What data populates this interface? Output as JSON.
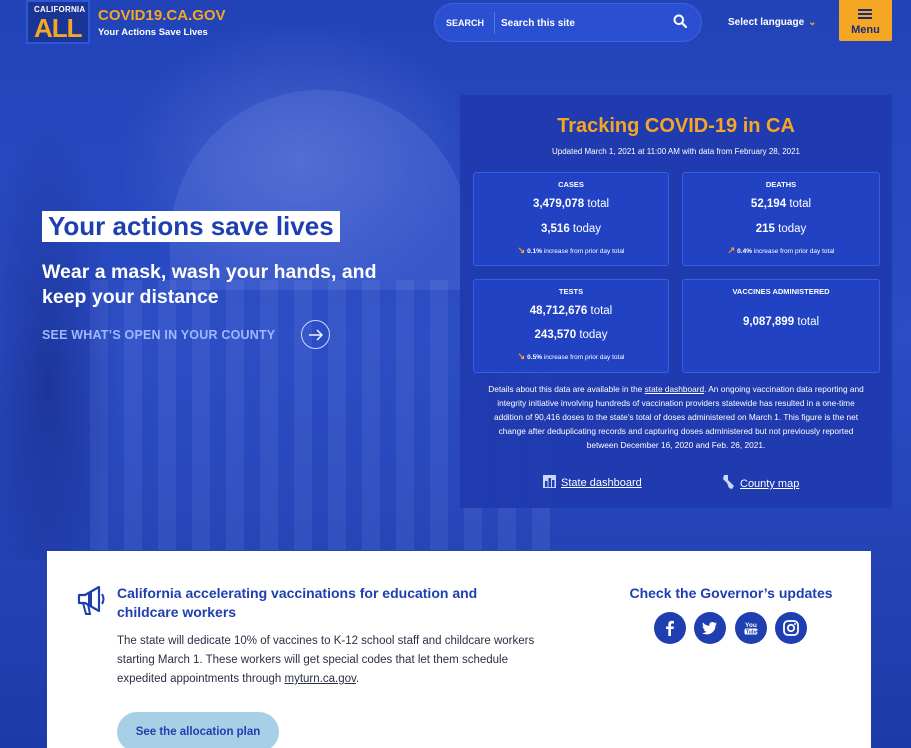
{
  "header": {
    "logo_small": "CALIFORNIA",
    "logo_big": "ALL",
    "site_title": "COVID19.CA.GOV",
    "site_subtitle": "Your Actions Save Lives",
    "search_label": "SEARCH",
    "search_placeholder": "Search this site",
    "language_label": "Select language",
    "menu_label": "Menu"
  },
  "hero": {
    "title": "Your actions save lives",
    "subtitle": "Wear a mask, wash your hands, and keep your distance",
    "link": "SEE WHAT’S OPEN IN YOUR COUNTY"
  },
  "tracking": {
    "title": "Tracking COVID-19 in CA",
    "updated": "Updated March 1, 2021 at 11:00 AM with data from February 28, 2021",
    "cards": {
      "cases": {
        "heading": "CASES",
        "total": "3,479,078",
        "total_unit": "total",
        "today": "3,516",
        "today_unit": "today",
        "change_pct": "0.1%",
        "change_text": "increase from prior day total"
      },
      "deaths": {
        "heading": "DEATHS",
        "total": "52,194",
        "total_unit": "total",
        "today": "215",
        "today_unit": "today",
        "change_pct": "0.4%",
        "change_text": "increase from prior day total"
      },
      "tests": {
        "heading": "TESTS",
        "total": "48,712,676",
        "total_unit": "total",
        "today": "243,570",
        "today_unit": "today",
        "change_pct": "0.5%",
        "change_text": "increase from prior day total"
      },
      "vaccines": {
        "heading": "VACCINES ADMINISTERED",
        "total": "9,087,899",
        "total_unit": "total"
      }
    },
    "note_pre": "Details about this data are available in the ",
    "note_link": "state dashboard",
    "note_post": ". An ongoing vaccination data reporting and integrity initiative involving hundreds of vaccination providers statewide has resulted in a one-time addition of 90,416 doses to the state’s total of doses administered on March 1. This figure is the net change after deduplicating records and capturing doses administered but not previously reported between December 16, 2020 and Feb. 26, 2021.",
    "link_dashboard": "State dashboard",
    "link_county": "County map"
  },
  "news": {
    "title": "California accelerating vaccinations for education and childcare workers",
    "body_pre": "The state will dedicate 10% of vaccines to K-12 school staff and childcare workers starting March 1. These workers will get special codes that let them schedule expedited appointments through ",
    "body_link": "myturn.ca.gov",
    "body_post": ".",
    "button": "See the allocation plan",
    "governor_heading": "Check the Governor’s updates",
    "social": [
      "facebook-icon",
      "twitter-icon",
      "youtube-icon",
      "instagram-icon"
    ]
  },
  "colors": {
    "brand_blue": "#1f3fb0",
    "accent_orange": "#f5a623",
    "button_light_blue": "#a7cfe6"
  }
}
